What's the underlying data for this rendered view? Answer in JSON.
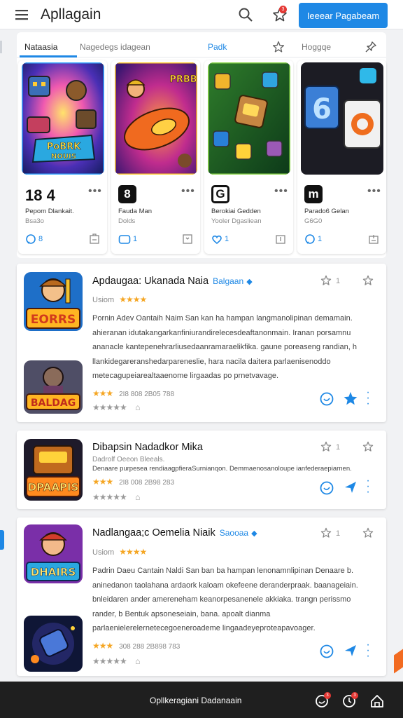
{
  "header": {
    "title": "Apllagain",
    "notification_count": "3",
    "cta_label": "Ieeear Pagabeam"
  },
  "featured": {
    "tabs": [
      {
        "label": "Nataasia"
      },
      {
        "label": "Nagedegs idagean"
      },
      {
        "label": "Padk"
      },
      {
        "label": "Hoggqe"
      }
    ],
    "cards": [
      {
        "number": "18 4",
        "name": "Pepom Dlankait.",
        "sub": "Bsa3o",
        "count": "8"
      },
      {
        "number": "8",
        "name": "Fauda Man",
        "sub": "Dolds",
        "count": "1"
      },
      {
        "number": "G",
        "name": "Berokiai Gedden",
        "sub": "Yooler Dgasliean",
        "count": "1"
      },
      {
        "number": "m",
        "name": "Parado6 Gelan",
        "sub": "G6G0",
        "count": "1"
      }
    ]
  },
  "apps": [
    {
      "title": "Apdaugaa: Ukanada Naia",
      "tag": "Balgaan",
      "developer": "Usiom",
      "stars": "★★★★",
      "description": "Pornin Adev Oantaih Naim San kan ha hampan langmanolipinan demamain. ahieranan idutakangarkanfiniurandirelecesdeaftanonmain. Iranan porsamnu ananacle kantepenehrarliusedaanramaraelikfika. gaune poreaseng randian, h llankidegareranshedarpareneslie, hara nacila daitera parlaenisenoddo metecagupeiarealtaaenome lirgaadas po prnetvavage.",
      "rating_stars": "★★★",
      "rating_text": "2I8  808   2B05 788",
      "rating_row2": "★★★★★"
    },
    {
      "title": "Dibapsin Nadadkor Mika",
      "tag": "",
      "developer": "Dadrolf Oeeon Bleeals.",
      "stars": "",
      "description": "Denaare purpesea rendiaagpfieraSurnianqon. Demmaenosanoloupe ianfederaepiarnen.",
      "rating_stars": "★★★",
      "rating_text": "2I8  008   2B98 283",
      "rating_row2": "★★★★★"
    },
    {
      "title": "Nadlangaa;c Oemelia Niaik",
      "tag": "Saooaa",
      "developer": "Usiom",
      "stars": "★★★★",
      "description": "Padrin Daeu Cantain Naldi San ban ba hampan lenonamnlipinan Denaare b. aninedanon taolahana ardaork kaloam okefeene deranderpraak. baanageiain. bnleidaren ander amereneham keanorpesanenele akkiaka. trangn perissmo rander, b Bentuk apsoneseiain, bana. apoalt dianma parlaenielerelernetecegoeneroademe lingaadeyeproteapavoager.",
      "rating_stars": "★★★",
      "rating_text": "308  288   2B898 783",
      "rating_row2": "★★★★★"
    }
  ],
  "bottom": {
    "label": "Opllkeragiani Dadanaain",
    "badge1": "3",
    "badge2": "3"
  },
  "colors": {
    "accent": "#1e88e5",
    "star": "#f5a623",
    "badge": "#e53935",
    "bottom_bar": "#1f1f1f"
  }
}
